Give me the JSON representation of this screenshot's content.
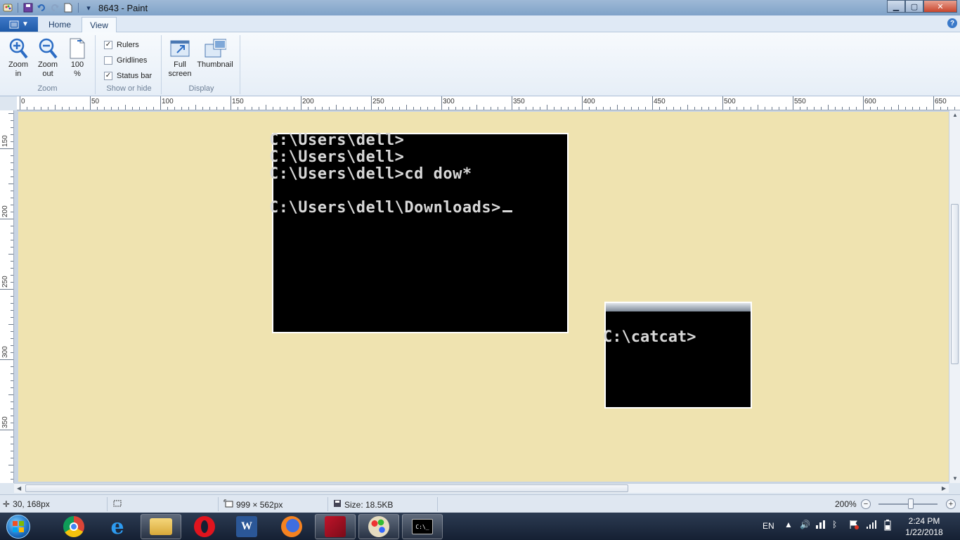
{
  "window": {
    "title": "8643 - Paint",
    "buttons": {
      "minimize": "▁",
      "maximize": "▢",
      "close": "✕"
    }
  },
  "ribbon": {
    "file_tab_icon": "menu-icon",
    "tabs": [
      {
        "label": "Home",
        "active": false
      },
      {
        "label": "View",
        "active": true
      }
    ],
    "help": "?",
    "groups": {
      "zoom": {
        "label": "Zoom",
        "zoom_in": "Zoom in",
        "zoom_out": "Zoom out",
        "hundred": "100 %"
      },
      "show_hide": {
        "label": "Show or hide",
        "rulers": {
          "label": "Rulers",
          "checked": true
        },
        "gridlines": {
          "label": "Gridlines",
          "checked": false
        },
        "status_bar": {
          "label": "Status bar",
          "checked": true
        }
      },
      "display": {
        "label": "Display",
        "full_screen": "Full screen",
        "thumbnail": "Thumbnail"
      }
    }
  },
  "rulers": {
    "horizontal_labels": [
      "0",
      "50",
      "100",
      "150",
      "200",
      "250",
      "300",
      "350",
      "400",
      "450",
      "500",
      "550",
      "600",
      "650"
    ],
    "vertical_labels": [
      "150",
      "200",
      "250",
      "300",
      "350"
    ]
  },
  "canvas": {
    "background": "#efe3b0",
    "console1": {
      "lines": [
        "C:\\Users\\dell>",
        "C:\\Users\\dell>",
        "C:\\Users\\dell>cd dow*",
        "",
        "C:\\Users\\dell\\Downloads>"
      ]
    },
    "console2": {
      "line": "C:\\catcat>"
    }
  },
  "statusbar": {
    "cursor_pos": "30, 168px",
    "selection": "",
    "dimensions": "999 × 562px",
    "size": "Size: 18.5KB",
    "zoom": "200%",
    "zoom_out": "−",
    "zoom_in": "+"
  },
  "taskbar": {
    "apps": [
      "chrome-icon",
      "internet-explorer-icon",
      "file-explorer-icon",
      "opera-icon",
      "word-icon",
      "firefox-icon",
      "autocad-icon",
      "paint-icon",
      "command-prompt-icon"
    ],
    "word_letter": "W",
    "cmd_label": "C:\\_",
    "language": "EN",
    "time": "2:24 PM",
    "date": "1/22/2018"
  }
}
